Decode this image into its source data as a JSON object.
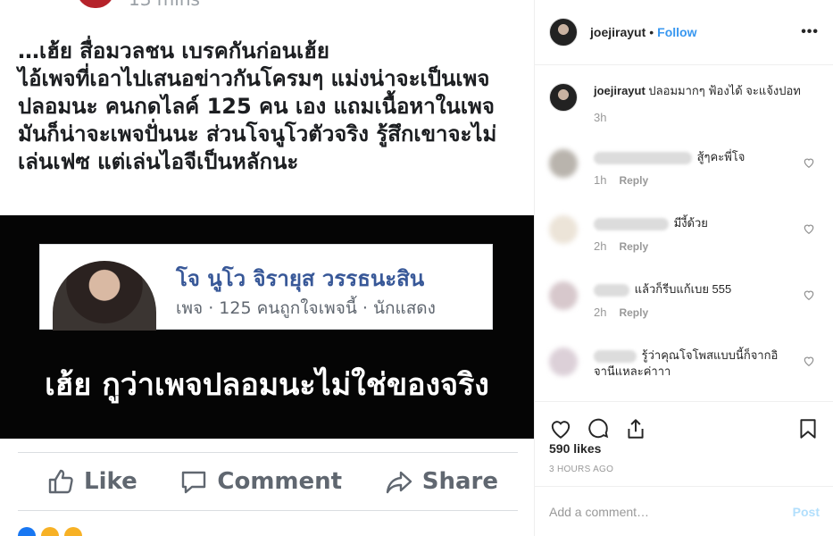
{
  "image": {
    "partial_top": "13 mins ·",
    "post_text_lines": [
      "…เฮ้ย สื่อมวลชน เบรคกันก่อนเฮ้ย",
      "ไอ้เพจที่เอาไปเสนอข่าวกันโครมๆ แม่งน่าจะเป็นเพจ",
      "ปลอมนะ คนกดไลค์ 125 คน เอง แถมเนื้อหาในเพจ",
      "มันก็น่าจะเพจปั่นนะ ส่วนโจนูโวตัวจริง รู้สึกเขาจะไม่",
      "เล่นเฟซ แต่เล่นไอจีเป็นหลักนะ"
    ],
    "card": {
      "name": "โจ นูโว จิรายุส วรรธนะสิน",
      "meta": "เพจ · 125 คนถูกใจเพจนี้ · นักแสดง",
      "caption": "เฮ้ย กูว่าเพจปลอมนะไม่ใช่ของจริง"
    },
    "actions": {
      "like": "Like",
      "comment": "Comment",
      "share": "Share"
    }
  },
  "sidebar": {
    "username": "joejirayut",
    "dot": "•",
    "follow": "Follow",
    "more": "•••",
    "caption": {
      "user": "joejirayut",
      "text": "ปลอมมากๆ ฟ้องได้ จะแจ้งปอท",
      "time": "3h"
    },
    "comments": [
      {
        "text": "สู้ๆคะพี่โจ",
        "time": "1h",
        "reply": "Reply",
        "avatar_color": "#b9b4ad"
      },
      {
        "text": "มีงี้ด้วย",
        "time": "2h",
        "reply": "Reply",
        "avatar_color": "#ece4d8"
      },
      {
        "text": "แล้วก็รีบแก้เบย 555",
        "time": "2h",
        "reply": "Reply",
        "avatar_color": "#d7c8cc"
      },
      {
        "text": "รู้ว่าคุณโจโพสแบบนี้ก็จากอิจานีแหละค่าาา",
        "time": "",
        "reply": "",
        "avatar_color": "#dcd0d8"
      }
    ],
    "likes": "590 likes",
    "timestamp": "3 HOURS AGO",
    "add_comment_placeholder": "Add a comment…",
    "post": "Post"
  },
  "colors": {
    "link": "#3897f0",
    "fb_blue": "#385898",
    "muted": "#999999"
  }
}
